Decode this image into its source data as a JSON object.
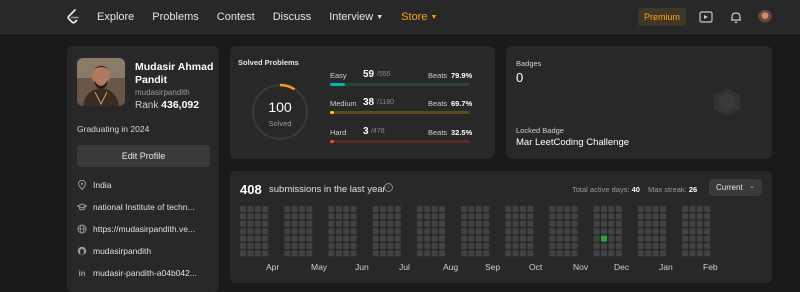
{
  "nav": {
    "links": [
      "Explore",
      "Problems",
      "Contest",
      "Discuss",
      "Interview",
      "Store"
    ],
    "premium_label": "Premium",
    "icons": [
      "leetcode-logo-icon",
      "play-icon",
      "bell-icon",
      "user-avatar-icon"
    ]
  },
  "profile": {
    "name": "Mudasir Ahmad Pandit",
    "username": "mudasirpandith",
    "rank_label": "Rank",
    "rank_value": "436,092",
    "graduation": "Graduating in 2024",
    "edit_label": "Edit Profile",
    "location": "India",
    "school": "national Institute of techn...",
    "website": "https://mudasirpandith.ve...",
    "github": "mudasirpandith",
    "linkedin": "mudasir-pandith-a04b042..."
  },
  "solved": {
    "title": "Solved Problems",
    "total": "100",
    "total_label": "Solved",
    "difficulties": [
      {
        "name": "Easy",
        "count": "59",
        "total": "/555",
        "beats_label": "Beats",
        "beats": "79.9%",
        "fraction": 0.106,
        "color": "#00b8a3",
        "track": "#26453e"
      },
      {
        "name": "Medium",
        "count": "38",
        "total": "/1180",
        "beats_label": "Beats",
        "beats": "69.7%",
        "fraction": 0.032,
        "color": "#ffc01e",
        "track": "#5a4a1e"
      },
      {
        "name": "Hard",
        "count": "3",
        "total": "/478",
        "beats_label": "Beats",
        "beats": "32.5%",
        "fraction": 0.006,
        "color": "#ef4743",
        "track": "#5a2a28"
      }
    ]
  },
  "badges": {
    "label": "Badges",
    "count": "0",
    "locked_label": "Locked Badge",
    "locked_name": "Mar LeetCoding Challenge"
  },
  "submissions": {
    "count": "408",
    "text": "submissions in the last year",
    "active_label": "Total active days:",
    "active_value": "40",
    "streak_label": "Max streak:",
    "streak_value": "26",
    "dropdown": "Current",
    "months": [
      "Apr",
      "May",
      "Jun",
      "Jul",
      "Aug",
      "Sep",
      "Oct",
      "Nov",
      "Dec",
      "Jan",
      "Feb"
    ]
  }
}
